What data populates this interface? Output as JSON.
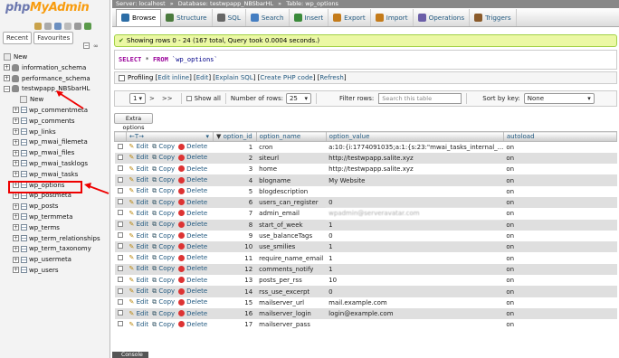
{
  "brand": {
    "logo_php": "php",
    "logo_myadmin": "MyAdmin"
  },
  "sidebar": {
    "tabs": [
      "Recent",
      "Favourites"
    ],
    "tree": [
      {
        "label": "New",
        "kind": "new",
        "indent": 0
      },
      {
        "label": "information_schema",
        "kind": "db",
        "indent": 0
      },
      {
        "label": "performance_schema",
        "kind": "db",
        "indent": 0
      },
      {
        "label": "testwpapp_NBSbarHL",
        "kind": "db-open",
        "indent": 0
      },
      {
        "label": "New",
        "kind": "new",
        "indent": 1
      },
      {
        "label": "wp_commentmeta",
        "kind": "tbl",
        "indent": 1
      },
      {
        "label": "wp_comments",
        "kind": "tbl",
        "indent": 1
      },
      {
        "label": "wp_links",
        "kind": "tbl",
        "indent": 1
      },
      {
        "label": "wp_mwai_filemeta",
        "kind": "tbl",
        "indent": 1
      },
      {
        "label": "wp_mwai_files",
        "kind": "tbl",
        "indent": 1
      },
      {
        "label": "wp_mwai_tasklogs",
        "kind": "tbl",
        "indent": 1
      },
      {
        "label": "wp_mwai_tasks",
        "kind": "tbl",
        "indent": 1
      },
      {
        "label": "wp_options",
        "kind": "tbl",
        "indent": 1
      },
      {
        "label": "wp_postmeta",
        "kind": "tbl",
        "indent": 1
      },
      {
        "label": "wp_posts",
        "kind": "tbl",
        "indent": 1
      },
      {
        "label": "wp_termmeta",
        "kind": "tbl",
        "indent": 1
      },
      {
        "label": "wp_terms",
        "kind": "tbl",
        "indent": 1
      },
      {
        "label": "wp_term_relationships",
        "kind": "tbl",
        "indent": 1
      },
      {
        "label": "wp_term_taxonomy",
        "kind": "tbl",
        "indent": 1
      },
      {
        "label": "wp_usermeta",
        "kind": "tbl",
        "indent": 1
      },
      {
        "label": "wp_users",
        "kind": "tbl",
        "indent": 1
      }
    ]
  },
  "breadcrumb": {
    "server": "Server: localhost",
    "database": "Database: testwpapp_NBSbarHL",
    "table": "Table: wp_options"
  },
  "menu": [
    "Browse",
    "Structure",
    "SQL",
    "Search",
    "Insert",
    "Export",
    "Import",
    "Operations",
    "Triggers"
  ],
  "message": "Showing rows 0 - 24 (167 total, Query took 0.0004 seconds.)",
  "sql": {
    "keyword1": "SELECT",
    "star": " * ",
    "keyword2": "FROM",
    "table": " `wp_options`"
  },
  "profiling": {
    "label": "Profiling",
    "links": [
      "Edit inline",
      "Edit",
      "Explain SQL",
      "Create PHP code",
      "Refresh"
    ]
  },
  "navbar": {
    "page": "1",
    "next": ">",
    "last": ">>",
    "show_all": "Show all",
    "rows_label": "Number of rows:",
    "rows_value": "25",
    "filter_label": "Filter rows:",
    "filter_placeholder": "Search this table",
    "sort_label": "Sort by key:",
    "sort_value": "None"
  },
  "extra_options": "Extra options",
  "table": {
    "headers": [
      "option_id",
      "option_name",
      "option_value",
      "autoload"
    ],
    "actions": {
      "edit": "Edit",
      "copy": "Copy",
      "delete": "Delete"
    },
    "rows": [
      {
        "id": "1",
        "name": "cron",
        "value": "a:10:{i:1774091035;a:1:{s:23:\"mwai_tasks_internal_...",
        "autoload": "on"
      },
      {
        "id": "2",
        "name": "siteurl",
        "value": "http://testwpapp.salite.xyz",
        "autoload": "on"
      },
      {
        "id": "3",
        "name": "home",
        "value": "http://testwpapp.salite.xyz",
        "autoload": "on"
      },
      {
        "id": "4",
        "name": "blogname",
        "value": "My Website",
        "autoload": "on"
      },
      {
        "id": "5",
        "name": "blogdescription",
        "value": "",
        "autoload": "on"
      },
      {
        "id": "6",
        "name": "users_can_register",
        "value": "0",
        "autoload": "on"
      },
      {
        "id": "7",
        "name": "admin_email",
        "value": "wpadmin@serveravatar.com",
        "autoload": "on",
        "blur": true
      },
      {
        "id": "8",
        "name": "start_of_week",
        "value": "1",
        "autoload": "on"
      },
      {
        "id": "9",
        "name": "use_balanceTags",
        "value": "0",
        "autoload": "on"
      },
      {
        "id": "10",
        "name": "use_smilies",
        "value": "1",
        "autoload": "on"
      },
      {
        "id": "11",
        "name": "require_name_email",
        "value": "1",
        "autoload": "on"
      },
      {
        "id": "12",
        "name": "comments_notify",
        "value": "1",
        "autoload": "on"
      },
      {
        "id": "13",
        "name": "posts_per_rss",
        "value": "10",
        "autoload": "on"
      },
      {
        "id": "14",
        "name": "rss_use_excerpt",
        "value": "0",
        "autoload": "on"
      },
      {
        "id": "15",
        "name": "mailserver_url",
        "value": "mail.example.com",
        "autoload": "on"
      },
      {
        "id": "16",
        "name": "mailserver_login",
        "value": "login@example.com",
        "autoload": "on"
      },
      {
        "id": "17",
        "name": "mailserver_pass",
        "value": "",
        "autoload": "on"
      }
    ]
  },
  "console": "Console",
  "colors": {
    "accent": "#235a81",
    "highlight": "#ee0000",
    "success_bg": "#ebf8a4"
  }
}
